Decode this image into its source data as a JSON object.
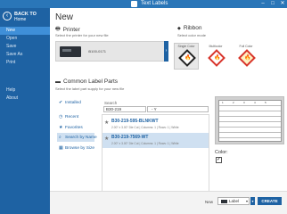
{
  "window": {
    "title": "Text Labels",
    "minimize_icon": "minimize-icon",
    "maximize_icon": "maximize-icon",
    "close_icon": "close-icon"
  },
  "sidebar": {
    "back_label": "BACK TO",
    "back_sub": "Home",
    "items": [
      {
        "label": "New"
      },
      {
        "label": "Open"
      },
      {
        "label": "Save"
      },
      {
        "label": "Save As"
      },
      {
        "label": "Print"
      },
      {
        "label": "Help"
      },
      {
        "label": "About"
      }
    ],
    "active_index": 0
  },
  "main": {
    "title": "New",
    "printer": {
      "title": "Printer",
      "subtitle": "Select the printer for your new file",
      "selected": "i5100-0171"
    },
    "ribbon": {
      "title": "Ribbon",
      "subtitle": "Select color mode",
      "options": [
        {
          "label": "Single Color",
          "selected": true
        },
        {
          "label": "Multicolor",
          "selected": false
        },
        {
          "label": "Full Color",
          "selected": false
        }
      ]
    },
    "parts": {
      "title": "Common Label Parts",
      "subtitle": "Select the label part supply for your new file",
      "tabs": [
        {
          "label": "Installed",
          "icon": "check-icon"
        },
        {
          "label": "Recent",
          "icon": "clock-icon"
        },
        {
          "label": "Favorites",
          "icon": "star-icon"
        },
        {
          "label": "Search by Name",
          "icon": "search-icon"
        },
        {
          "label": "Browse by Size",
          "icon": "grid-icon"
        }
      ],
      "active_tab": 3,
      "search_label": "Search",
      "search_value": "B30-219",
      "filter_value": "- Y",
      "results": [
        {
          "name": "B30-219-595-BLNKWT",
          "meta": "2.00\" x 3.00\" Die Cut | Columns: 1 | Rows: 1 | White"
        },
        {
          "name": "B30-219-7569-WT",
          "meta": "2.00\" x 3.00\" Die Cut | Columns: 1 | Rows: 1 | White"
        }
      ],
      "selected_result": 1
    },
    "preview": {
      "color_label": "Color:",
      "color_checked": true
    }
  },
  "footer": {
    "new_label": "New",
    "new_type": "Label",
    "create_label": "CREATE"
  }
}
